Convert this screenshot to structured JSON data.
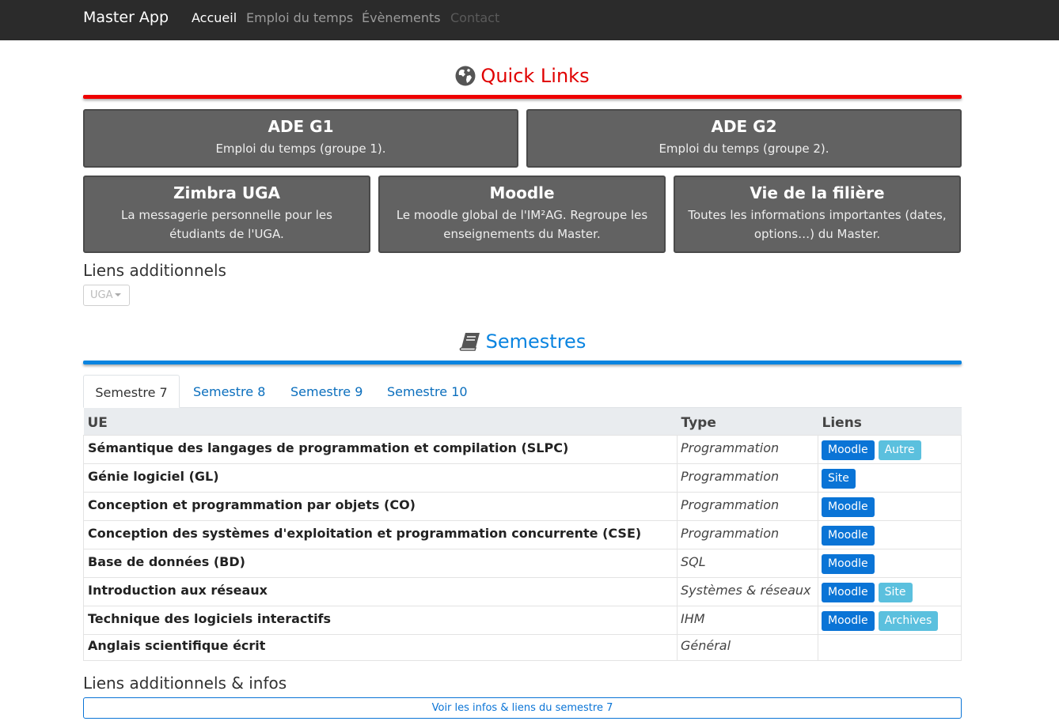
{
  "navbar": {
    "brand": "Master App",
    "links": [
      "Accueil",
      "Emploi du temps",
      "Évènements",
      "Contact"
    ]
  },
  "quick_links": {
    "title": "Quick Links",
    "icon": "globe-icon",
    "accent": "#ee0000",
    "cards": [
      {
        "title": "ADE G1",
        "desc": "Emploi du temps (groupe 1)."
      },
      {
        "title": "ADE G2",
        "desc": "Emploi du temps (groupe 2)."
      },
      {
        "title": "Zimbra UGA",
        "desc": "La messagerie personnelle pour les étudiants de l'UGA."
      },
      {
        "title": "Moodle",
        "desc": "Le moodle global de l'IM²AG. Regroupe les enseignements du Master."
      },
      {
        "title": "Vie de la filière",
        "desc": "Toutes les informations importantes (dates, options…) du Master."
      }
    ]
  },
  "additional": {
    "heading": "Liens additionnels",
    "dropdown_value": "UGA"
  },
  "semestres": {
    "title": "Semestres",
    "icon": "book-icon",
    "accent": "#0a84e0",
    "tabs": [
      "Semestre 7",
      "Semestre 8",
      "Semestre 9",
      "Semestre 10"
    ],
    "active_tab": "Semestre 7",
    "columns": [
      "UE",
      "Type",
      "Liens"
    ],
    "rows": [
      {
        "ue": "Sémantique des langages de programmation et compilation (SLPC)",
        "type": "Programmation",
        "links": [
          {
            "label": "Moodle",
            "style": "primary"
          },
          {
            "label": "Autre",
            "style": "info"
          }
        ]
      },
      {
        "ue": "Génie logiciel (GL)",
        "type": "Programmation",
        "links": [
          {
            "label": "Site",
            "style": "primary"
          }
        ]
      },
      {
        "ue": "Conception et programmation par objets (CO)",
        "type": "Programmation",
        "links": [
          {
            "label": "Moodle",
            "style": "primary"
          }
        ]
      },
      {
        "ue": "Conception des systèmes d'exploitation et programmation concurrente (CSE)",
        "type": "Programmation",
        "links": [
          {
            "label": "Moodle",
            "style": "primary"
          }
        ]
      },
      {
        "ue": "Base de données (BD)",
        "type": "SQL",
        "links": [
          {
            "label": "Moodle",
            "style": "primary"
          }
        ]
      },
      {
        "ue": "Introduction aux réseaux",
        "type": "Systèmes & réseaux",
        "links": [
          {
            "label": "Moodle",
            "style": "primary"
          },
          {
            "label": "Site",
            "style": "info"
          }
        ]
      },
      {
        "ue": "Technique des logiciels interactifs",
        "type": "IHM",
        "links": [
          {
            "label": "Moodle",
            "style": "primary"
          },
          {
            "label": "Archives",
            "style": "info"
          }
        ]
      },
      {
        "ue": "Anglais scientifique écrit",
        "type": "Général",
        "links": []
      }
    ],
    "more_heading": "Liens additionnels & infos",
    "more_button": "Voir les infos & liens du semestre 7"
  }
}
